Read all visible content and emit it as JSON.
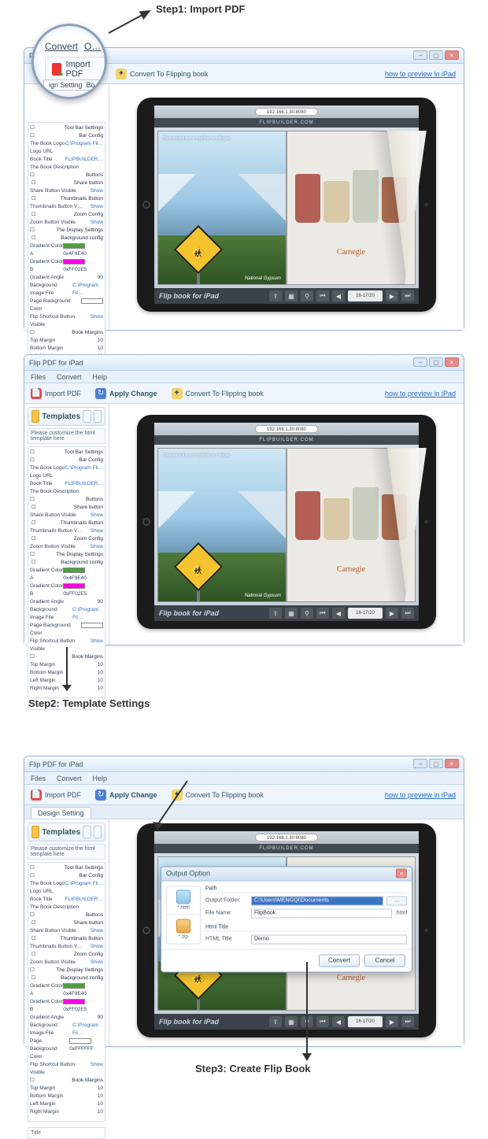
{
  "steps": {
    "s1": "Step1: Import PDF",
    "s2": "Step2: Template Settings",
    "s3": "Step3: Create Flip Book"
  },
  "window": {
    "title": "Flip PDF for iPad",
    "menus": [
      "Files",
      "Convert",
      "Help"
    ],
    "toolbar": {
      "import": "Import PDF",
      "apply": "Apply Change",
      "convert": "Convert To Flipping book",
      "preview_link": "how to preview in iPad"
    },
    "tab": "Design Setting"
  },
  "magnifier": {
    "menu1": "Convert",
    "menu2": "O…",
    "button": "Import PDF",
    "tab1": "ign Setting",
    "tab2": "Bo"
  },
  "sidebar": {
    "templates": "Templates",
    "hint": "Please customize the html template here",
    "tree": {
      "toolbar_settings": "Tool Bar Settings",
      "bar_config": "Bar Config",
      "book_logo": "The Book Logo",
      "book_logo_val": "C:\\Program Fil…",
      "logo_url": "Logo URL",
      "book_title": "Book Title",
      "book_title_val": "FLIPBUILDER…",
      "book_desc": "The Book Description",
      "buttons": "Buttons",
      "share_btn": "Share button",
      "share_vis": "Share Button Visible",
      "show": "Show",
      "thumb_btn": "Thumbnails Button",
      "thumb_vis": "Thumbnails Button V…",
      "zoom_cfg": "Zoom Config",
      "zoom_vis": "Zoom Button Visible",
      "display": "The Display Settings",
      "bg_config": "Background config",
      "grad_a": "Gradient Color A",
      "grad_a_val": "0x4F9E40",
      "grad_b": "Gradient Color B",
      "grad_b_val": "0xFF02E5",
      "grad_angle": "Gradient Angle",
      "grad_angle_val": "90",
      "bg_img": "Background Image File",
      "bg_img_val": "C:\\Program Fil…",
      "page_bg": "Page Background Color",
      "page_bg_val": "0xFFFFFF",
      "flip_sc": "Flip Shortcut Button Visible",
      "margins": "Book Margins",
      "top_m": "Top Margin",
      "top_v": "10",
      "bot_m": "Bottom Margin",
      "bot_v": "10",
      "left_m": "Left Margin",
      "left_v": "10",
      "right_m": "Right Margin",
      "right_v": "10"
    },
    "title_label": "Title"
  },
  "ipad": {
    "addr": "192.168.1.30:8080",
    "site": "FLIPBUILDER.COM",
    "flipbook_title": "Flip book for iPad",
    "left_headline": "Consistent insurer together in colleges.",
    "brand_left": "National Gypsum",
    "brand_right": "Carnegie",
    "page_count": "16-17/20"
  },
  "dialog": {
    "title": "Output Option",
    "side_html": "*.html",
    "side_zip": "*.zip",
    "grp_path": "Path",
    "output_folder": "Output Folder:",
    "output_folder_val": "C:\\Users\\MENGQI\\Documents",
    "file_name": "File Name:",
    "file_name_val": "FlipBook",
    "ext": ".html",
    "grp_html": "Html Title",
    "html_title": "HTML Title",
    "html_title_val": "Demo",
    "convert": "Convert",
    "cancel": "Cancel"
  }
}
